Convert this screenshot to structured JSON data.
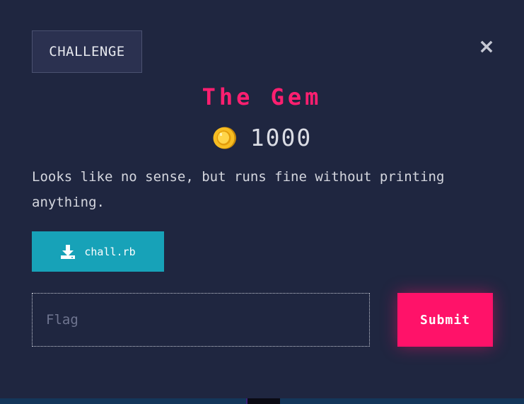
{
  "modal": {
    "category_label": "CHALLENGE",
    "close_icon": "close-x-icon",
    "title": "The Gem",
    "points": {
      "icon": "gold-coin-icon",
      "value": "1000"
    },
    "description": "Looks like no sense, but runs fine without printing anything.",
    "attachment": {
      "icon": "download-icon",
      "filename": "chall.rb"
    },
    "flag_input": {
      "value": "",
      "placeholder": "Flag"
    },
    "submit_label": "Submit"
  },
  "colors": {
    "background": "#1f2640",
    "title": "#ff1f70",
    "download_button": "#17a2b8",
    "submit_button": "#ff1269",
    "coin": "#f5b71a"
  }
}
